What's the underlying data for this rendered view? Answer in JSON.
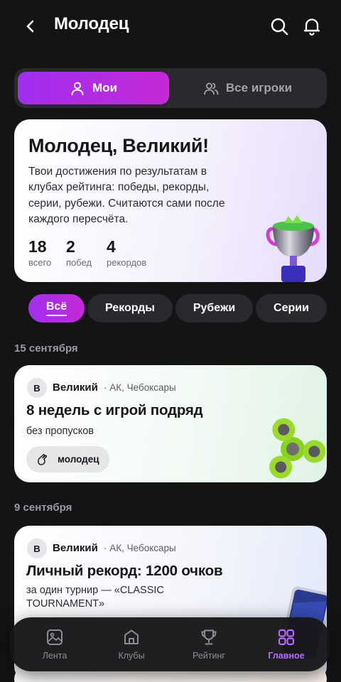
{
  "header": {
    "title": "Молодец"
  },
  "segment": {
    "mine": "Мои",
    "all_players": "Все игроки"
  },
  "summary": {
    "title": "Молодец, Великий!",
    "description": "Твои достижения по результатам в клубах рейтинга: победы, рекорды, серии, рубежи. Считаются сами после каждого пересчёта.",
    "stats": [
      {
        "value": "18",
        "label": "всего"
      },
      {
        "value": "2",
        "label": "побед"
      },
      {
        "value": "4",
        "label": "рекордов"
      }
    ]
  },
  "filters": {
    "all": "Всё",
    "records": "Рекорды",
    "milestones": "Рубежи",
    "series": "Серии"
  },
  "feed": [
    {
      "date": "15 сентября",
      "avatar": "В",
      "user": "Великий",
      "location": "· АК, Чебоксары",
      "title": "8 недель с игрой подряд",
      "subtitle": "без пропусков",
      "tag": "молодец"
    },
    {
      "date": "9 сентября",
      "avatar": "В",
      "user": "Великий",
      "location": "· АК, Чебоксары",
      "title": "Личный рекорд: 1200 очков",
      "subtitle": "за один турнир — «CLASSIC TOURNAMENT»"
    }
  ],
  "tabbar": {
    "feed": "Лента",
    "clubs": "Клубы",
    "rating": "Рейтинг",
    "main": "Главное",
    "active_color": "#b66bff"
  },
  "colors": {
    "accent_start": "#a12ef0",
    "accent_end": "#c42ad6",
    "background": "#141416"
  },
  "icons": [
    "back-icon",
    "search-icon",
    "bell-icon",
    "user-icon",
    "users-icon",
    "hand-icon",
    "image-icon",
    "home-icon",
    "trophy-icon",
    "grid-icon"
  ]
}
